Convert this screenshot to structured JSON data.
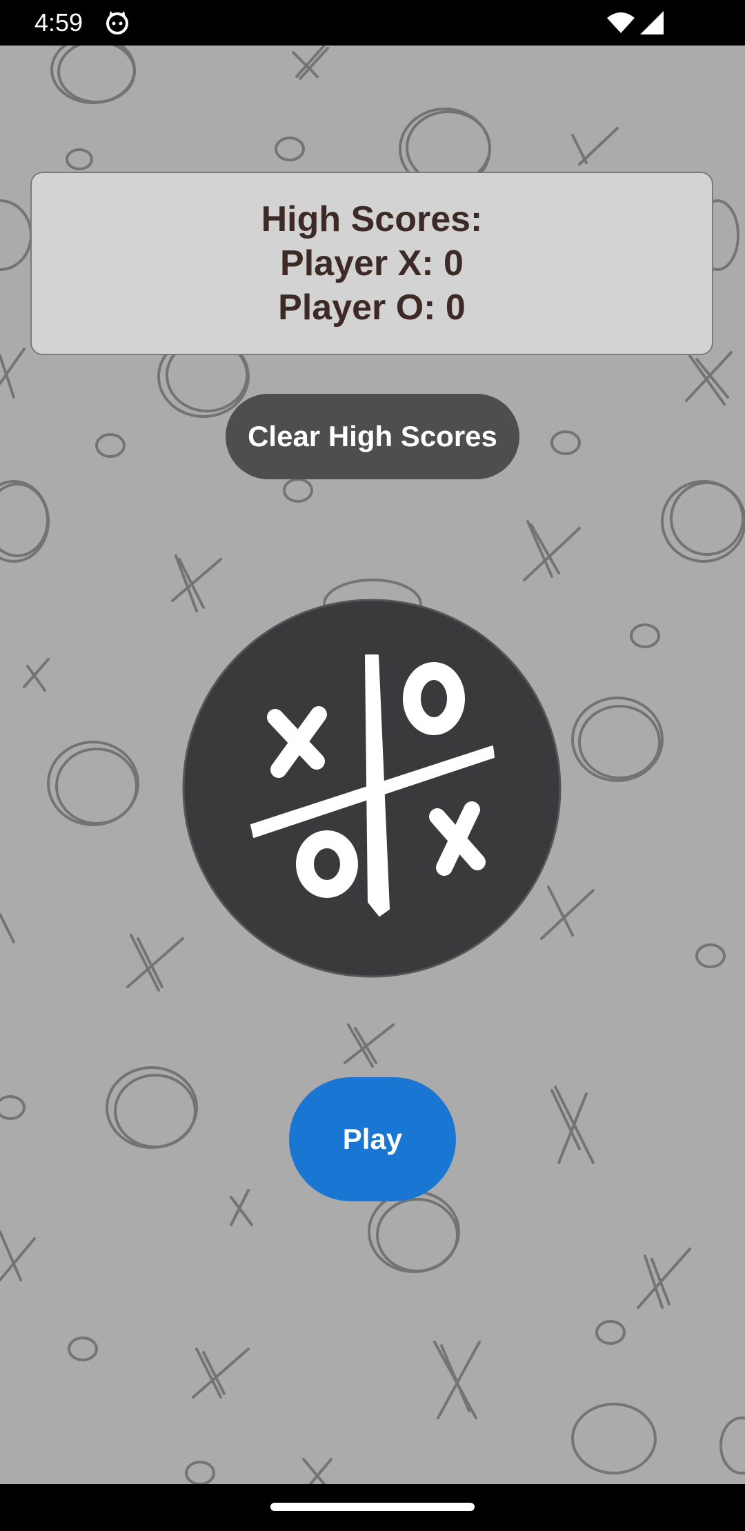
{
  "status_bar": {
    "time": "4:59",
    "icons": [
      "cat-icon",
      "wifi-icon",
      "signal-icon"
    ]
  },
  "high_scores": {
    "title": "High Scores:",
    "player_x_line": "Player X: 0",
    "player_o_line": "Player O: 0"
  },
  "clear_button": {
    "label": "Clear High Scores"
  },
  "logo": {
    "icon": "tic-tac-toe-logo-icon"
  },
  "play_button": {
    "label": "Play"
  },
  "colors": {
    "background": "#ababab",
    "card": "#d3d3d3",
    "card_text": "#3d2a27",
    "clear_button": "#4e4e4e",
    "play_button": "#1976d2",
    "logo_circle": "#3a3a3d"
  }
}
